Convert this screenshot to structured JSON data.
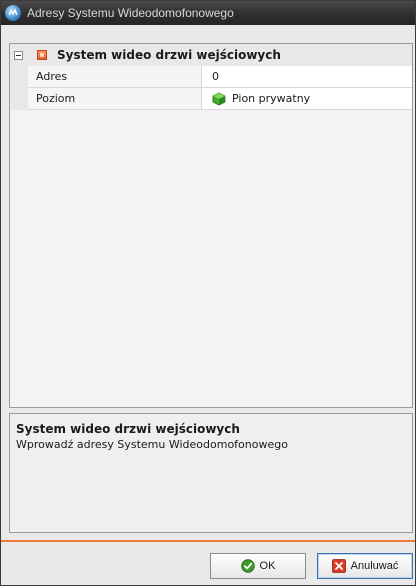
{
  "window": {
    "title": "Adresy Systemu Wideodomofonowego"
  },
  "grid": {
    "category": {
      "label": "System wideo drzwi wejściowych"
    },
    "properties": [
      {
        "name": "Adres",
        "value": "0"
      },
      {
        "name": "Poziom",
        "value": "Pion prywatny",
        "icon": "green-gem-icon"
      }
    ]
  },
  "description": {
    "title": "System wideo drzwi wejściowych",
    "text": "Wprowadź adresy Systemu Wideodomofonowego"
  },
  "buttons": {
    "ok_label": "OK",
    "cancel_label": "Anuluwać"
  },
  "colors": {
    "accent": "#f07a3a",
    "titlebar": "#2e2e2e"
  }
}
